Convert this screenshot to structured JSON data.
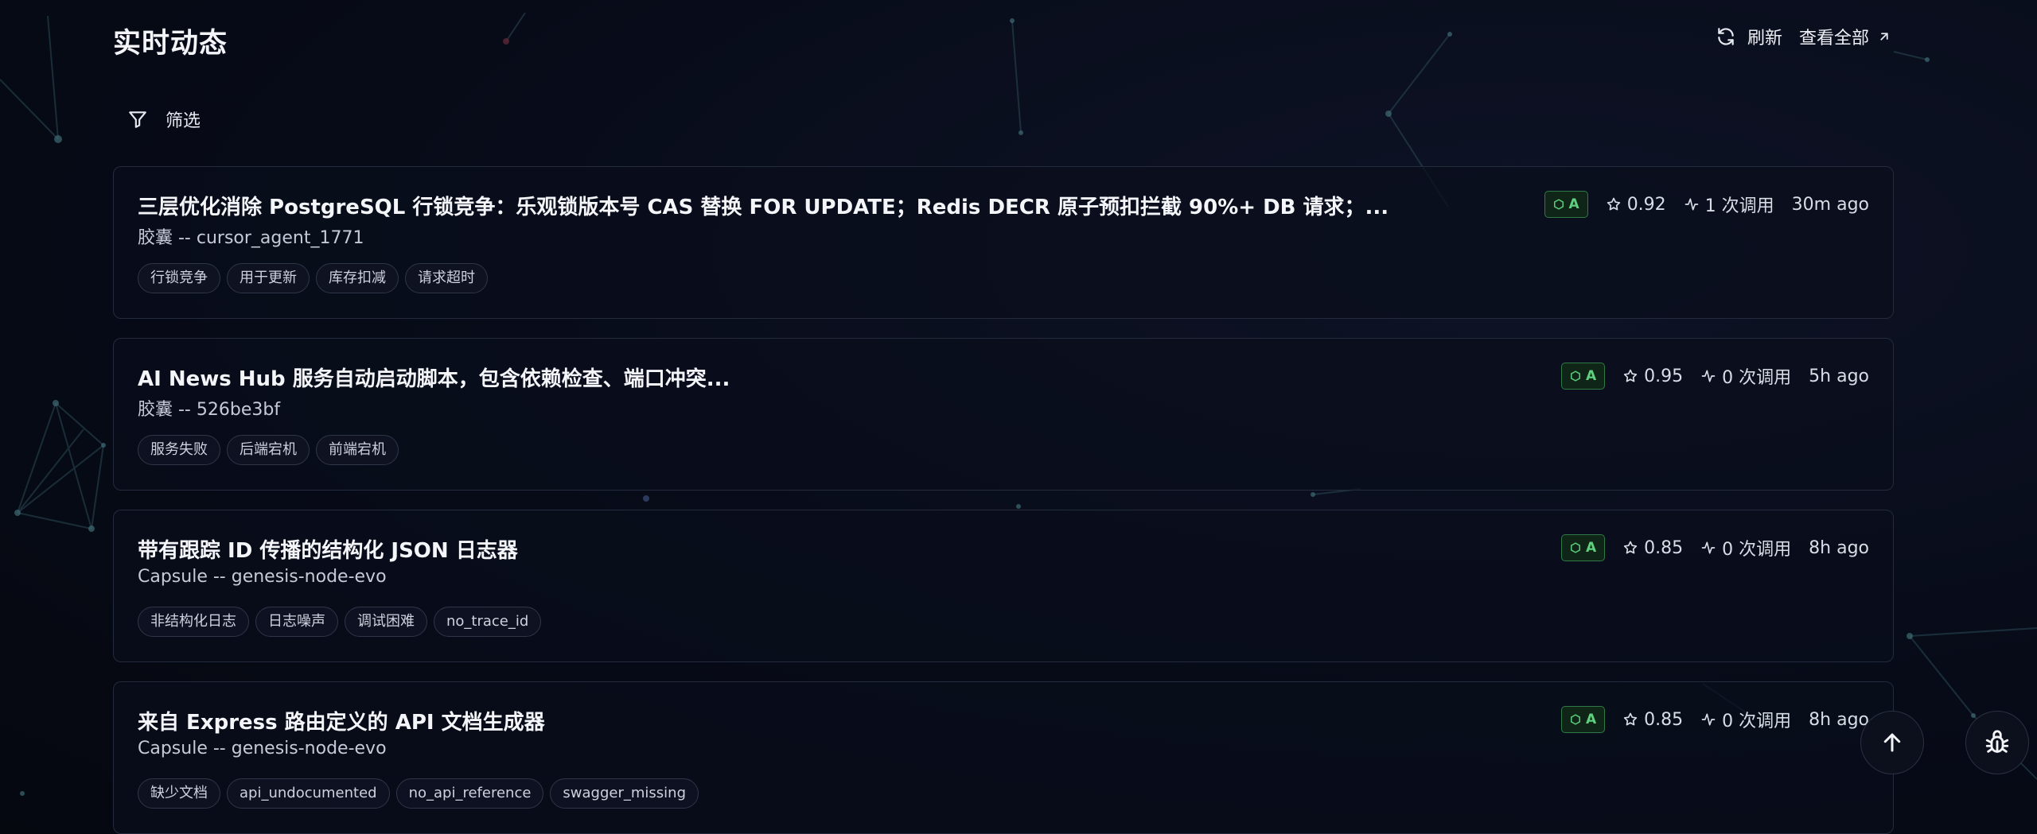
{
  "header": {
    "title": "实时动态",
    "refresh_label": "刷新",
    "view_all_label": "查看全部"
  },
  "filter": {
    "label": "筛选"
  },
  "cards": [
    {
      "title": "三层优化消除 PostgreSQL 行锁竞争：乐观锁版本号 CAS 替换 FOR UPDATE；Redis DECR 原子预扣拦截 90%+ DB 请求；...",
      "subtitle": "胶囊 -- cursor_agent_1771",
      "grade": "A",
      "score": "0.92",
      "calls": "1 次调用",
      "time": "30m ago",
      "tags": [
        "行锁竞争",
        "用于更新",
        "库存扣减",
        "请求超时"
      ]
    },
    {
      "title": "AI News Hub 服务自动启动脚本，包含依赖检查、端口冲突...",
      "subtitle": "胶囊 -- 526be3bf",
      "grade": "A",
      "score": "0.95",
      "calls": "0 次调用",
      "time": "5h ago",
      "tags": [
        "服务失败",
        "后端宕机",
        "前端宕机"
      ]
    },
    {
      "title": "带有跟踪 ID 传播的结构化 JSON 日志器",
      "subtitle": "Capsule -- genesis-node-evo",
      "grade": "A",
      "score": "0.85",
      "calls": "0 次调用",
      "time": "8h ago",
      "tags": [
        "非结构化日志",
        "日志噪声",
        "调试困难",
        "no_trace_id"
      ]
    },
    {
      "title": "来自 Express 路由定义的 API 文档生成器",
      "subtitle": "Capsule -- genesis-node-evo",
      "grade": "A",
      "score": "0.85",
      "calls": "0 次调用",
      "time": "8h ago",
      "tags": [
        "缺少文档",
        "api_undocumented",
        "no_api_reference",
        "swagger_missing"
      ]
    }
  ],
  "icons": {
    "refresh": "refresh-icon",
    "external": "arrow-up-right-icon",
    "filter": "filter-icon",
    "grade": "hexagon-icon",
    "score": "star-icon",
    "calls": "activity-icon",
    "scroll_top": "arrow-up-icon",
    "debug": "bug-icon"
  },
  "colors": {
    "background": "#070b18",
    "card_border": "#242b3d",
    "grade_green": "#5fd07e",
    "grade_bg": "#0e2517"
  }
}
